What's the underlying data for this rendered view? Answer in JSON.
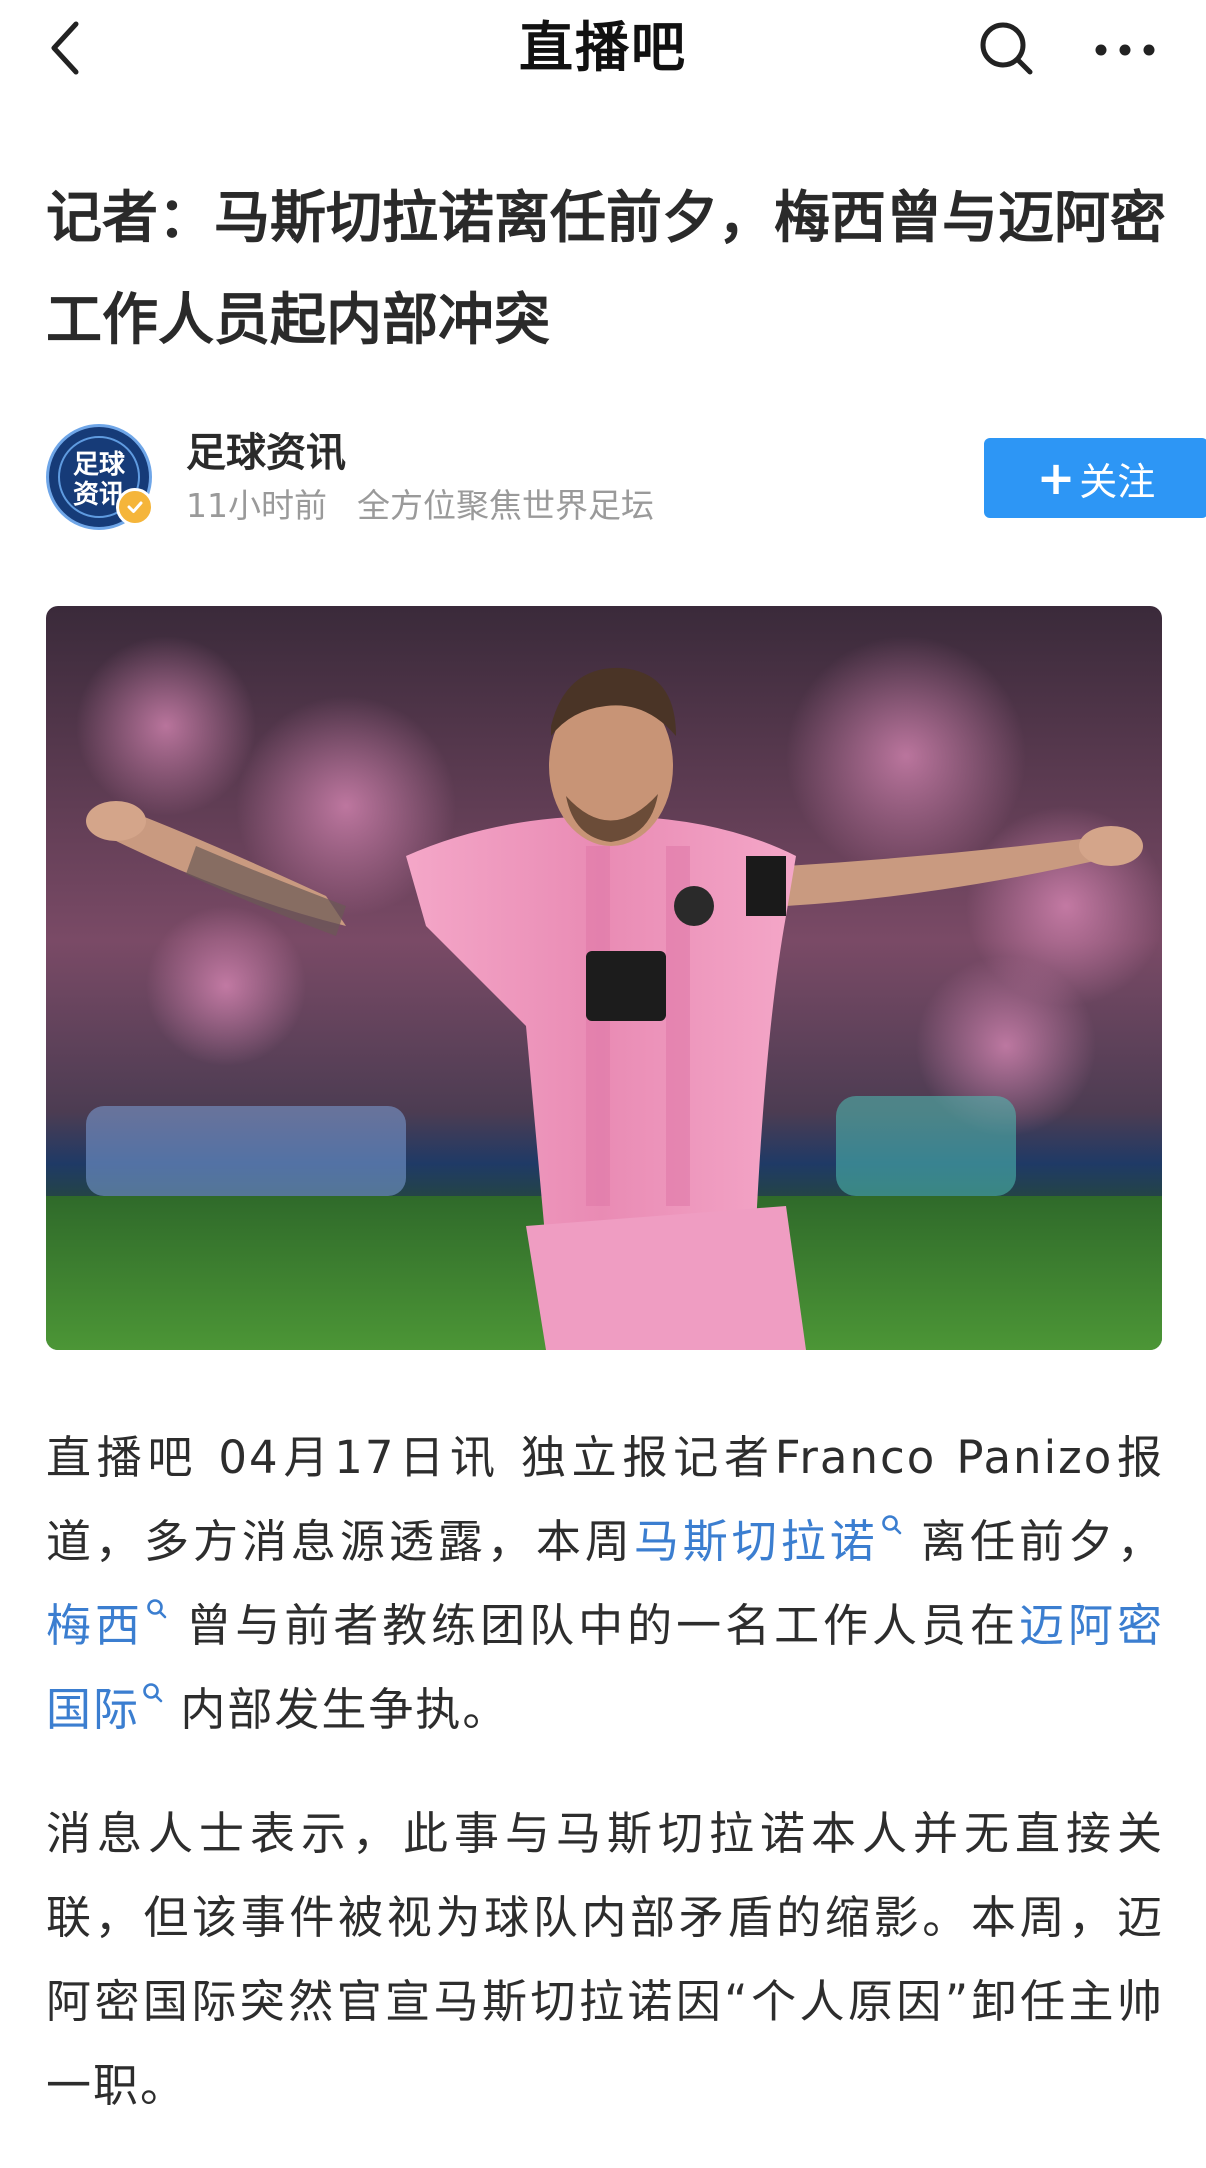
{
  "header": {
    "app_name": "直播吧",
    "back_icon": "chevron-left-icon",
    "search_icon": "search-icon",
    "more_icon": "more-horizontal-icon"
  },
  "article": {
    "title": "记者：马斯切拉诺离任前夕，梅西曾与迈阿密工作人员起内部冲突",
    "author": {
      "avatar_text_top": "足球",
      "avatar_text_bottom": "资讯",
      "name": "足球资讯",
      "time": "11小时前",
      "tagline": "全方位聚焦世界足坛",
      "verified": true
    },
    "follow_label": "关注",
    "body": {
      "p1_text1": "直播吧 04月17日讯  独立报记者Franco  Panizo报道，多方消息源透露，本周",
      "p1_link1": "马斯切拉诺",
      "p1_text2": "离任前夕，",
      "p1_link2": "梅西",
      "p1_text3": "曾与前者教练团队中的一名工作人员在",
      "p1_link3": "迈阿密国际",
      "p1_text4": "内部发生争执。",
      "p2": "消息人士表示，此事与马斯切拉诺本人并无直接关联，但该事件被视为球队内部矛盾的缩影。本周，迈阿密国际突然官宣马斯切拉诺因“个人原因”卸任主帅一职。"
    }
  },
  "colors": {
    "accent": "#2d96f5",
    "link": "#3b7ed0",
    "badge": "#f5b53a"
  }
}
